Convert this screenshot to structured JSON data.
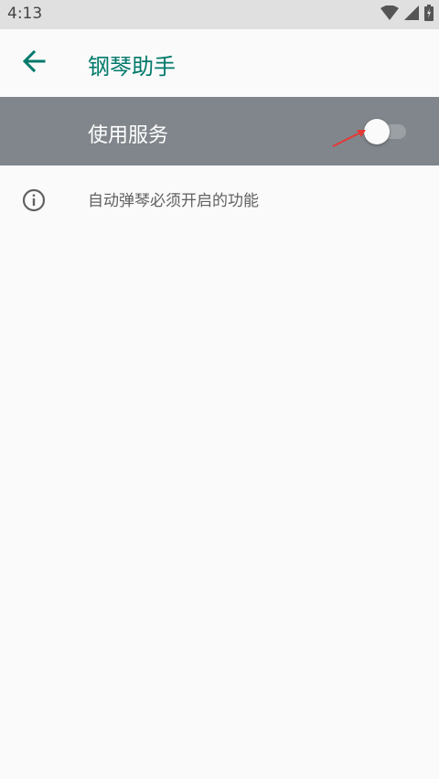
{
  "status_bar": {
    "time": "4:13",
    "icons": [
      "wifi-icon",
      "cell-signal-icon",
      "battery-icon"
    ]
  },
  "app_bar": {
    "back_icon": "arrow-left-icon",
    "title": "钢琴助手"
  },
  "service_switch": {
    "label": "使用服务",
    "enabled": false
  },
  "info": {
    "icon": "info-icon",
    "text": "自动弹琴必须开启的功能"
  },
  "colors": {
    "accent": "#00796b",
    "switch_bar_bg": "#80868b",
    "background": "#fafafa",
    "annotation": "#e53935"
  }
}
